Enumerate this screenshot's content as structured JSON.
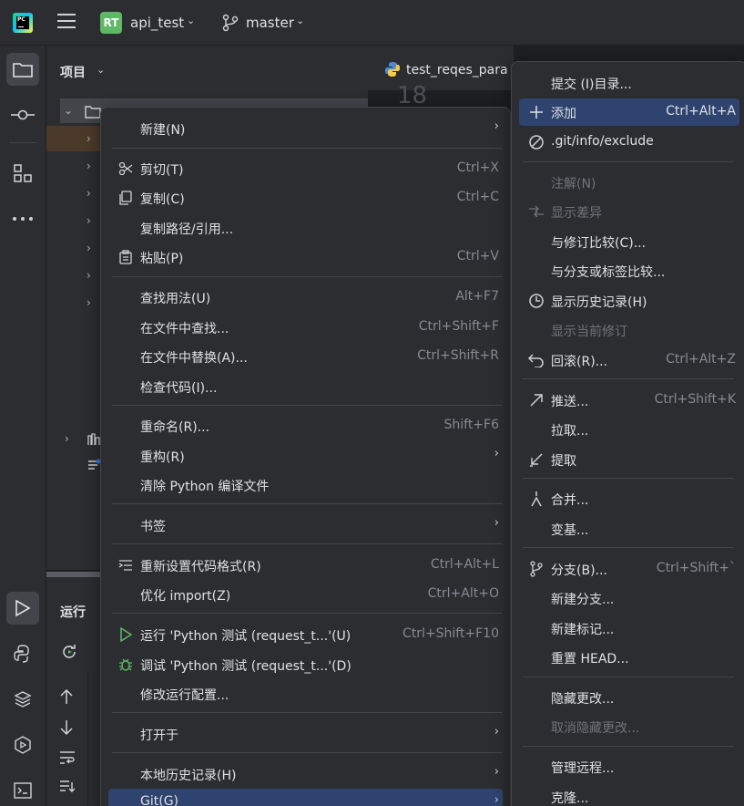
{
  "titlebar": {
    "project_badge": "RT",
    "project_name": "api_test",
    "branch": "master"
  },
  "project_pane": {
    "title": "项目"
  },
  "run_pane": {
    "title": "运行"
  },
  "editor": {
    "tab_label": "test_reqes_para",
    "gutter_line": "18"
  },
  "context_menu": {
    "items": [
      {
        "label": "新建(N)",
        "submenu": true
      },
      {
        "label": "剪切(T)",
        "shortcut": "Ctrl+X",
        "icon": "scissors-icon"
      },
      {
        "label": "复制(C)",
        "shortcut": "Ctrl+C",
        "icon": "copy-icon"
      },
      {
        "label": "复制路径/引用..."
      },
      {
        "label": "粘贴(P)",
        "shortcut": "Ctrl+V",
        "icon": "paste-icon"
      },
      {
        "label": "查找用法(U)",
        "shortcut": "Alt+F7"
      },
      {
        "label": "在文件中查找...",
        "shortcut": "Ctrl+Shift+F"
      },
      {
        "label": "在文件中替换(A)...",
        "shortcut": "Ctrl+Shift+R"
      },
      {
        "label": "检查代码(I)..."
      },
      {
        "label": "重命名(R)...",
        "shortcut": "Shift+F6"
      },
      {
        "label": "重构(R)",
        "submenu": true
      },
      {
        "label": "清除 Python 编译文件"
      },
      {
        "label": "书签",
        "submenu": true
      },
      {
        "label": "重新设置代码格式(R)",
        "shortcut": "Ctrl+Alt+L",
        "icon": "reformat-icon"
      },
      {
        "label": "优化 import(Z)",
        "shortcut": "Ctrl+Alt+O"
      },
      {
        "label": "运行 'Python 测试 (request_t...'(U)",
        "shortcut": "Ctrl+Shift+F10",
        "icon": "run-icon"
      },
      {
        "label": "调试 'Python 测试 (request_t...'(D)",
        "icon": "debug-icon"
      },
      {
        "label": "修改运行配置..."
      },
      {
        "label": "打开于",
        "submenu": true
      },
      {
        "label": "本地历史记录(H)",
        "submenu": true
      },
      {
        "label": "Git(G)",
        "submenu": true
      }
    ]
  },
  "git_menu": {
    "items": [
      {
        "label": "提交 (I)目录..."
      },
      {
        "label": "添加",
        "shortcut": "Ctrl+Alt+A",
        "icon": "plus-icon"
      },
      {
        "label": ".git/info/exclude",
        "icon": "ignore-icon"
      },
      {
        "label": "注解(N)",
        "disabled": true
      },
      {
        "label": "显示差异",
        "disabled": true,
        "icon": "diff-icon"
      },
      {
        "label": "与修订比较(C)..."
      },
      {
        "label": "与分支或标签比较..."
      },
      {
        "label": "显示历史记录(H)",
        "icon": "history-icon"
      },
      {
        "label": "显示当前修订",
        "disabled": true
      },
      {
        "label": "回滚(R)...",
        "shortcut": "Ctrl+Alt+Z",
        "icon": "rollback-icon"
      },
      {
        "label": "推送...",
        "shortcut": "Ctrl+Shift+K",
        "icon": "push-icon"
      },
      {
        "label": "拉取..."
      },
      {
        "label": "提取",
        "icon": "fetch-icon"
      },
      {
        "label": "合并...",
        "icon": "merge-icon"
      },
      {
        "label": "变基..."
      },
      {
        "label": "分支(B)...",
        "shortcut": "Ctrl+Shift+`",
        "icon": "branch-icon"
      },
      {
        "label": "新建分支..."
      },
      {
        "label": "新建标记..."
      },
      {
        "label": "重置 HEAD..."
      },
      {
        "label": "隐藏更改..."
      },
      {
        "label": "取消隐藏更改...",
        "disabled": true
      },
      {
        "label": "管理远程..."
      },
      {
        "label": "克隆..."
      }
    ]
  },
  "colors": {
    "highlight": "#2e436e",
    "menu_bg": "#2b2d30",
    "badge": "#5fb865"
  }
}
